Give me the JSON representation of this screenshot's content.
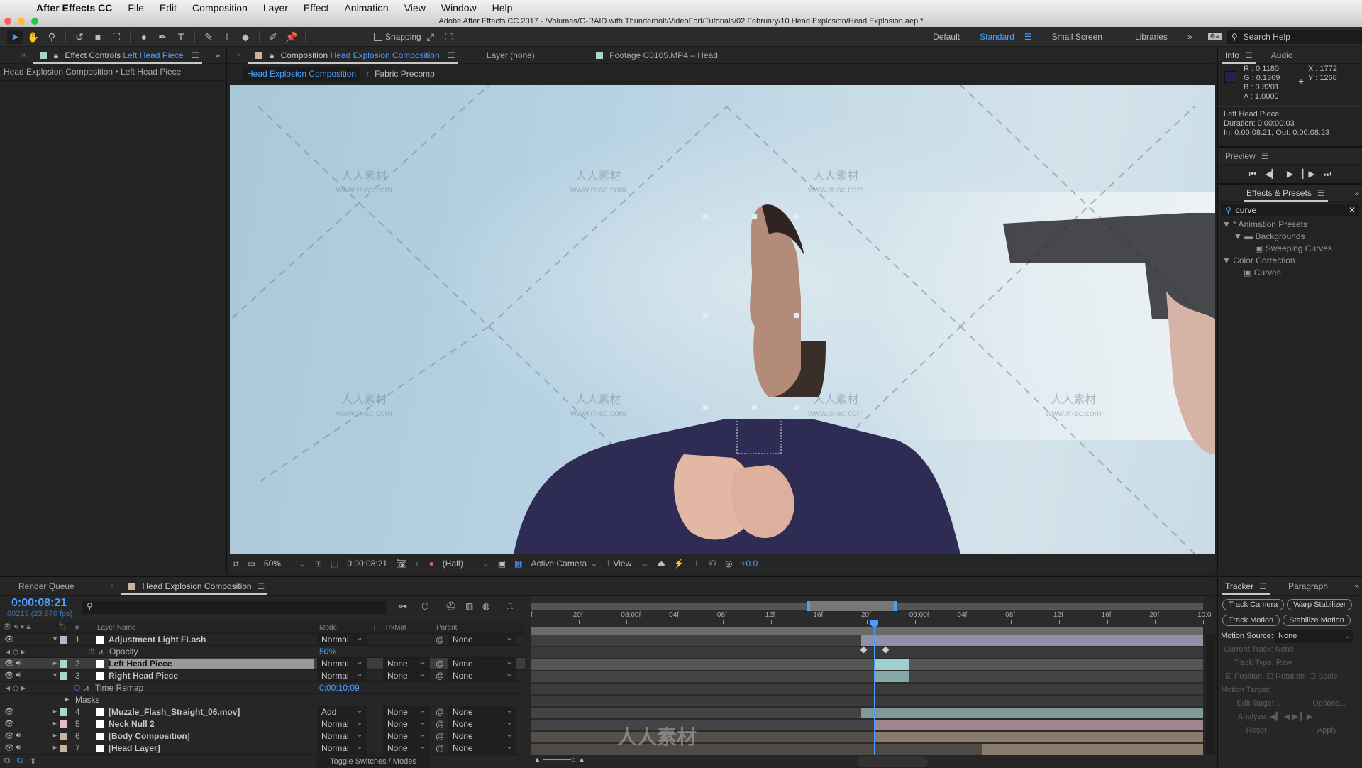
{
  "menubar": {
    "app_name": "After Effects CC",
    "items": [
      "File",
      "Edit",
      "Composition",
      "Layer",
      "Effect",
      "Animation",
      "View",
      "Window",
      "Help"
    ]
  },
  "window_title": "Adobe After Effects CC 2017 - /Volumes/G-RAID with Thunderbolt/VideoFort/Tutorials/02 February/10 Head Explosion/Head Explosion.aep *",
  "toolbar": {
    "tools": [
      "selection-tool",
      "hand-tool",
      "zoom-tool",
      "rotation-tool",
      "camera-tool",
      "pan-behind-tool",
      "ellipse-tool",
      "pen-tool",
      "type-tool",
      "brush-tool",
      "clone-stamp-tool",
      "eraser-tool",
      "roto-brush-tool",
      "puppet-pin-tool"
    ],
    "snapping_label": "Snapping",
    "workspaces": [
      "Default",
      "Standard",
      "Small Screen",
      "Libraries"
    ],
    "active_workspace": "Standard",
    "search_placeholder": "Search Help"
  },
  "effect_controls": {
    "tab_prefix": "Effect Controls",
    "tab_layer": "Left Head Piece",
    "breadcrumb": "Head Explosion Composition • Left Head Piece"
  },
  "composition_panel": {
    "tab_prefix": "Composition",
    "tab_name": "Head Explosion Composition",
    "layer_tab": "Layer (none)",
    "footage_tab": "Footage C0105.MP4 – Head",
    "nav": [
      "Head Explosion Composition",
      "Fabric Precomp"
    ],
    "viewer_bar": {
      "zoom": "50%",
      "timecode": "0:00:08:21",
      "resolution": "(Half)",
      "camera": "Active Camera",
      "views": "1 View",
      "exposure": "+0.0"
    }
  },
  "watermarks": {
    "cn": "人人素材",
    "url": "www.rr-sc.com"
  },
  "info_panel": {
    "tabs": [
      "Info",
      "Audio"
    ],
    "color": {
      "R": "0.1180",
      "G": "0.1369",
      "B": "0.3201",
      "A": "1.0000",
      "swatch": "#1e2352"
    },
    "X": "1772",
    "Y": "1268",
    "layer_name": "Left Head Piece",
    "duration": "Duration: 0:00:00:03",
    "in_out": "In: 0:00:08:21, Out: 0:00:08:23"
  },
  "preview_panel": {
    "title": "Preview"
  },
  "effects_presets": {
    "title": "Effects & Presets",
    "search_value": "curve",
    "tree": [
      {
        "label": "* Animation Presets",
        "level": 0
      },
      {
        "label": "Backgrounds",
        "level": 1
      },
      {
        "label": "Sweeping Curves",
        "level": 2
      },
      {
        "label": "Color Correction",
        "level": 0
      },
      {
        "label": "Curves",
        "level": 1
      }
    ]
  },
  "timeline": {
    "tabs": [
      "Render Queue",
      "Head Explosion Composition"
    ],
    "current_time": "0:00:08:21",
    "frame_info": "00213 (23.976 fps)",
    "columns": {
      "layer_name": "Layer Name",
      "mode": "Mode",
      "t": "T",
      "trkmat": "TrkMat",
      "parent": "Parent",
      "num": "#"
    },
    "ruler": [
      "f",
      "20f",
      "08:00f",
      "04f",
      "08f",
      "12f",
      "16f",
      "20f",
      "09:00f",
      "04f",
      "08f",
      "12f",
      "16f",
      "20f",
      "10:0"
    ],
    "layers": [
      {
        "num": "1",
        "name": "Adjustment Light FLash",
        "mode": "Normal",
        "trkmat": "",
        "parent": "None",
        "label": "#b8b3d6",
        "twirl": "▼"
      },
      {
        "num": "2",
        "name": "Left Head Piece",
        "mode": "Normal",
        "trkmat": "None",
        "parent": "None",
        "label": "#a9d6cf",
        "twirl": "►",
        "selected": true
      },
      {
        "num": "3",
        "name": "Right Head Piece",
        "mode": "Normal",
        "trkmat": "None",
        "parent": "None",
        "label": "#a9d6cf",
        "twirl": "▼"
      },
      {
        "num": "4",
        "name": "[Muzzle_Flash_Straight_06.mov]",
        "mode": "Add",
        "trkmat": "None",
        "parent": "None",
        "label": "#a9d6cf",
        "twirl": "►"
      },
      {
        "num": "5",
        "name": "Neck Null 2",
        "mode": "Normal",
        "trkmat": "None",
        "parent": "None",
        "label": "#e6b9c9",
        "twirl": "►"
      },
      {
        "num": "6",
        "name": "[Body Composition]",
        "mode": "Normal",
        "trkmat": "None",
        "parent": "None",
        "label": "#c8b49a",
        "twirl": "►"
      },
      {
        "num": "7",
        "name": "[Head Layer]",
        "mode": "Normal",
        "trkmat": "None",
        "parent": "None",
        "label": "#c8b49a",
        "twirl": "►"
      }
    ],
    "props": {
      "opacity_label": "Opacity",
      "opacity_value": "50%",
      "time_remap_label": "Time Remap",
      "time_remap_value": "0:00:10:09",
      "masks_label": "Masks"
    },
    "toggle_label": "Toggle Switches / Modes"
  },
  "tracker": {
    "tabs": [
      "Tracker",
      "Paragraph"
    ],
    "buttons": [
      "Track Camera",
      "Warp Stabilizer",
      "Track Motion",
      "Stabilize Motion"
    ],
    "motion_source_label": "Motion Source:",
    "motion_source_value": "None",
    "current_track_label": "Current Track:",
    "current_track_value": "None",
    "track_type_label": "Track Type:",
    "track_type_value": "Raw",
    "checks": [
      {
        "label": "Position",
        "checked": true
      },
      {
        "label": "Rotation",
        "checked": false
      },
      {
        "label": "Scale",
        "checked": false
      }
    ],
    "motion_target_label": "Motion Target:",
    "edit_target": "Edit Target...",
    "options": "Options...",
    "analyze_label": "Analyze:",
    "reset": "Reset",
    "apply": "Apply"
  }
}
